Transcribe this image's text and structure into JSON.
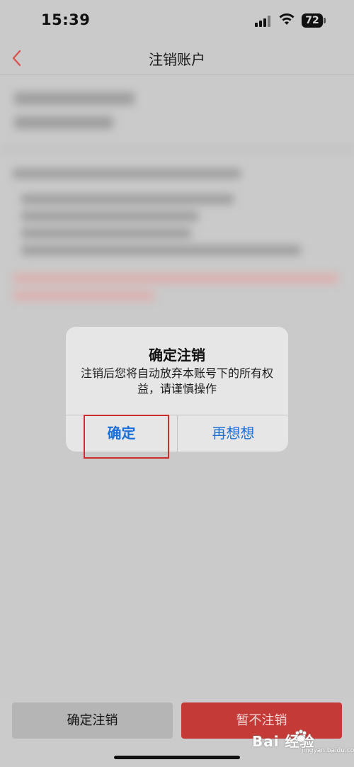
{
  "status_bar": {
    "time": "15:39",
    "battery_level": "72"
  },
  "nav": {
    "title": "注销账户"
  },
  "alert": {
    "title": "确定注销",
    "message": "注销后您将自动放弃本账号下的所有权益，请谨慎操作",
    "confirm_label": "确定",
    "rethink_label": "再想想"
  },
  "bottom_bar": {
    "confirm_cancel_label": "确定注销",
    "keep_label": "暂不注销"
  },
  "watermark": {
    "text": "Bai 经验",
    "sub": "jingyan.baidu.com"
  },
  "colors": {
    "accent_blue": "#1a6fd6",
    "danger_red": "#c43a36",
    "highlight_red": "#cc2e2e"
  }
}
